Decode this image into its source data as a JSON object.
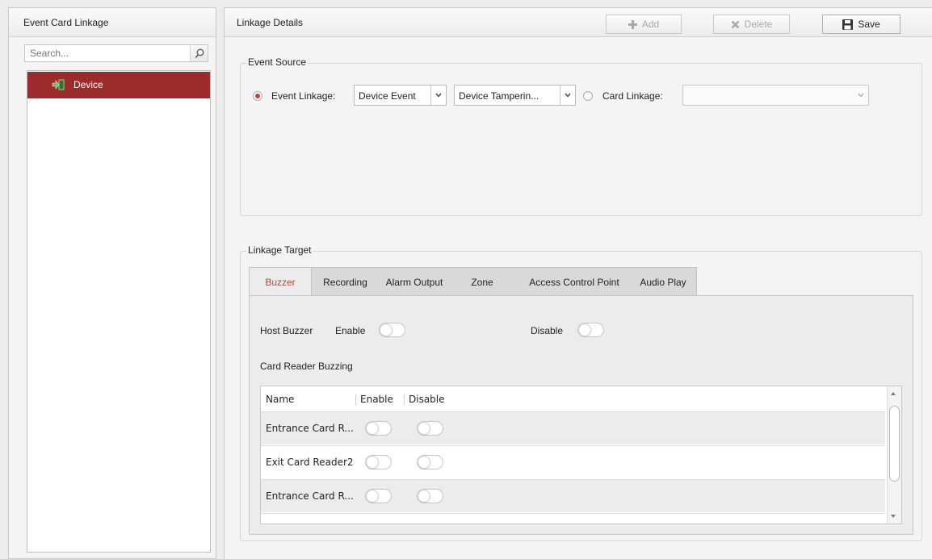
{
  "left_panel": {
    "title": "Event Card Linkage",
    "search": {
      "placeholder": "Search..."
    },
    "tree": [
      {
        "label": "Device",
        "icon": "device-import-icon",
        "selected": true
      }
    ]
  },
  "right_panel": {
    "title": "Linkage Details",
    "toolbar": {
      "add_label": "Add",
      "delete_label": "Delete",
      "save_label": "Save"
    },
    "event_source": {
      "legend": "Event Source",
      "event_linkage_label": "Event Linkage:",
      "event_linkage_checked": true,
      "event_type_value": "Device Event",
      "event_value": "Device Tamperin...",
      "card_linkage_label": "Card Linkage:",
      "card_linkage_checked": false,
      "card_linkage_value": ""
    },
    "linkage_target": {
      "legend": "Linkage Target",
      "tabs": [
        {
          "label": "Buzzer",
          "active": true
        },
        {
          "label": "Recording"
        },
        {
          "label": "Alarm Output"
        },
        {
          "label": "Zone"
        },
        {
          "label": "Access Control Point"
        },
        {
          "label": "Audio Play"
        }
      ],
      "host_buzzer_label": "Host Buzzer",
      "enable_label": "Enable",
      "disable_label": "Disable",
      "card_reader_buzzing_label": "Card Reader Buzzing",
      "table": {
        "columns": [
          "Name",
          "Enable",
          "Disable"
        ],
        "rows": [
          {
            "name": "Entrance Card R...",
            "enable": false,
            "disable": false
          },
          {
            "name": "Exit Card Reader2",
            "enable": false,
            "disable": false
          },
          {
            "name": "Entrance Card R...",
            "enable": false,
            "disable": false
          }
        ]
      }
    }
  },
  "colors": {
    "accent": "#c8403a",
    "selection": "#9e2b2b"
  }
}
